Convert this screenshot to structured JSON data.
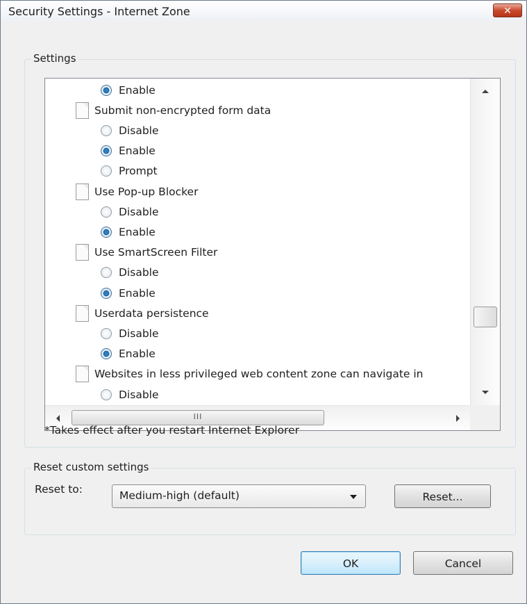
{
  "window": {
    "title": "Security Settings - Internet Zone",
    "close_glyph": "✕",
    "accent_close": "#c94a2e"
  },
  "settings_group": {
    "legend": "Settings",
    "rows": [
      {
        "kind": "option",
        "label": "Enable",
        "selected": true
      },
      {
        "kind": "category",
        "label": "Submit non-encrypted form data",
        "icon": "document-icon"
      },
      {
        "kind": "option",
        "label": "Disable",
        "selected": false
      },
      {
        "kind": "option",
        "label": "Enable",
        "selected": true
      },
      {
        "kind": "option",
        "label": "Prompt",
        "selected": false
      },
      {
        "kind": "category",
        "label": "Use Pop-up Blocker",
        "icon": "document-icon"
      },
      {
        "kind": "option",
        "label": "Disable",
        "selected": false
      },
      {
        "kind": "option",
        "label": "Enable",
        "selected": true
      },
      {
        "kind": "category",
        "label": "Use SmartScreen Filter",
        "icon": "document-icon"
      },
      {
        "kind": "option",
        "label": "Disable",
        "selected": false
      },
      {
        "kind": "option",
        "label": "Enable",
        "selected": true
      },
      {
        "kind": "category",
        "label": "Userdata persistence",
        "icon": "document-icon"
      },
      {
        "kind": "option",
        "label": "Disable",
        "selected": false
      },
      {
        "kind": "option",
        "label": "Enable",
        "selected": true
      },
      {
        "kind": "category",
        "label": "Websites in less privileged web content zone can navigate in",
        "icon": "document-icon"
      },
      {
        "kind": "option",
        "label": "Disable",
        "selected": false
      }
    ],
    "hscroll_grip": "III",
    "note": "*Takes effect after you restart Internet Explorer"
  },
  "reset_group": {
    "legend": "Reset custom settings",
    "reset_to_label": "Reset to:",
    "level_value": "Medium-high (default)",
    "reset_button": "Reset..."
  },
  "buttons": {
    "ok": "OK",
    "cancel": "Cancel"
  }
}
